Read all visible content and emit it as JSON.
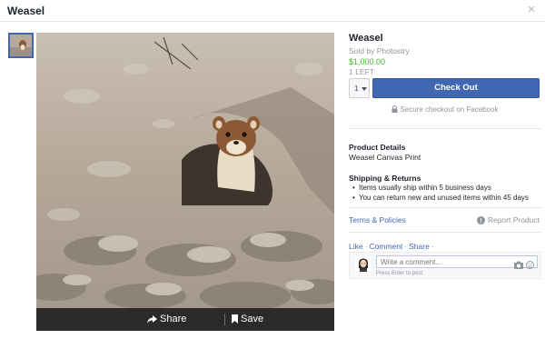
{
  "window": {
    "title": "Weasel"
  },
  "photo_actions": {
    "share_label": "Share",
    "save_label": "Save"
  },
  "product": {
    "title": "Weasel",
    "seller": "Sold by Photostry",
    "price": "$1,000.00",
    "stock": "1 LEFT",
    "quantity": "1",
    "checkout_label": "Check Out",
    "secure_text": "Secure checkout on Facebook"
  },
  "details": {
    "heading": "Product Details",
    "text": "Weasel Canvas Print"
  },
  "shipping": {
    "heading": "Shipping & Returns",
    "items": [
      "Items usually ship within 5 business days",
      "You can return new and unused items within 45 days"
    ]
  },
  "links": {
    "terms": "Terms & Policies",
    "report": "Report Product"
  },
  "social": {
    "like": "Like",
    "comment": "Comment",
    "share": "Share",
    "separator": "·",
    "comment_placeholder": "Write a comment...",
    "comment_hint": "Press Enter to post."
  },
  "colors": {
    "accent": "#4267b2",
    "price": "#42b72a",
    "muted": "#90949c"
  }
}
